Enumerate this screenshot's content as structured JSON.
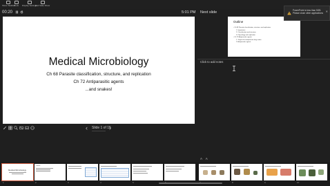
{
  "toolbar": {
    "buttons": [
      {
        "label": "Show Taskbar"
      },
      {
        "label": "Tools"
      },
      {
        "label": "Display Settings"
      },
      {
        "label": "End Slide Show"
      }
    ]
  },
  "presenter": {
    "timer": "00:20",
    "clock": "5:01 PM",
    "next_slide_label": "Next slide",
    "notes_placeholder": "Click to add notes",
    "slide_counter": "Slide 1 of 15"
  },
  "current_slide": {
    "title": "Medical Microbiology",
    "lines": [
      "Ch 68 Parasite classification, structure, and replication",
      "Ch 72 Antiparasitic agents",
      "...and snakes!"
    ]
  },
  "next_slide": {
    "title": "Outline",
    "items": [
      "• Ch 68 Parasite classification, structure, and replication",
      "1. Importance",
      "2. Classification and structure",
      "3. Physiology and replication",
      "• Ch 72 Antiparasitic agents",
      "1. Targets for antiparasitic drug action",
      "2. Antiparasitic agents"
    ]
  },
  "notification": {
    "text": "PowerPoint is less than 5GB. Please close other applications"
  },
  "thumbnails": [
    {
      "num": "1",
      "title": "Medical Microbiology"
    },
    {
      "num": "2",
      "title": "Outline"
    },
    {
      "num": "3",
      "title": ""
    },
    {
      "num": "4",
      "title": ""
    },
    {
      "num": "5",
      "title": ""
    },
    {
      "num": "6",
      "title": ""
    },
    {
      "num": "7",
      "title": ""
    },
    {
      "num": "8",
      "title": ""
    },
    {
      "num": "9",
      "title": ""
    },
    {
      "num": "10",
      "title": ""
    }
  ],
  "font_controls": "A A",
  "colors": {
    "background": "#1f1f1f",
    "active_thumb": "#c9563a",
    "toast_warning": "#e8b13a"
  }
}
